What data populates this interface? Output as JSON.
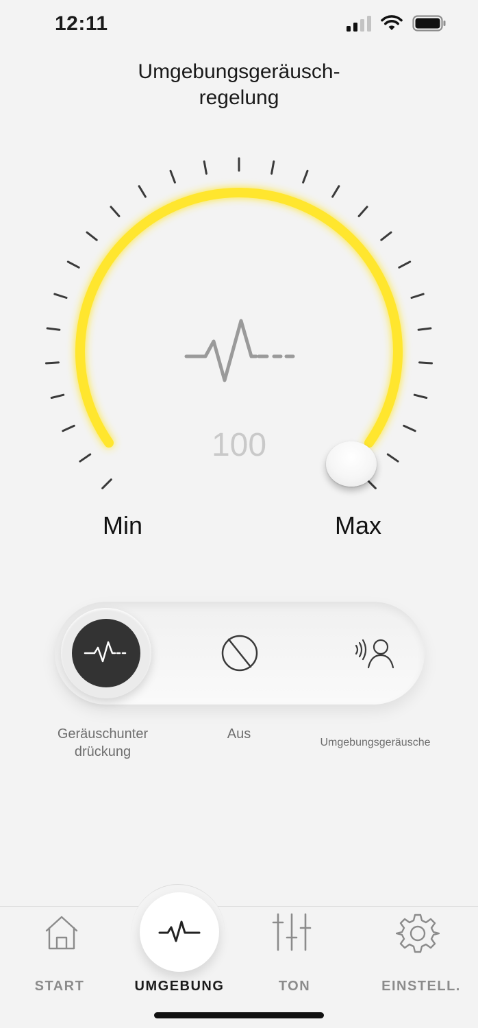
{
  "status_bar": {
    "time": "12:11"
  },
  "header": {
    "title_line1": "Umgebungsgeräusch-",
    "title_line2": "regelung"
  },
  "dial": {
    "value": "100",
    "min_label": "Min",
    "max_label": "Max",
    "level_percent": 100,
    "accent_color": "#FFE62E"
  },
  "mode_selector": {
    "modes": [
      {
        "label_line1": "Geräuschunter",
        "label_line2": "drückung",
        "icon": "noise-cancel-icon",
        "active": true
      },
      {
        "label": "Aus",
        "icon": "off-icon",
        "active": false
      },
      {
        "label": "Umgebungsgeräusche",
        "icon": "ambient-sound-icon",
        "active": false
      }
    ]
  },
  "bottom_nav": {
    "items": [
      {
        "label": "START",
        "icon": "home-icon",
        "active": false
      },
      {
        "label": "UMGEBUNG",
        "icon": "waveform-icon",
        "active": true
      },
      {
        "label": "TON",
        "icon": "equalizer-icon",
        "active": false
      },
      {
        "label": "EINSTELL.",
        "icon": "gear-icon",
        "active": false
      }
    ]
  }
}
